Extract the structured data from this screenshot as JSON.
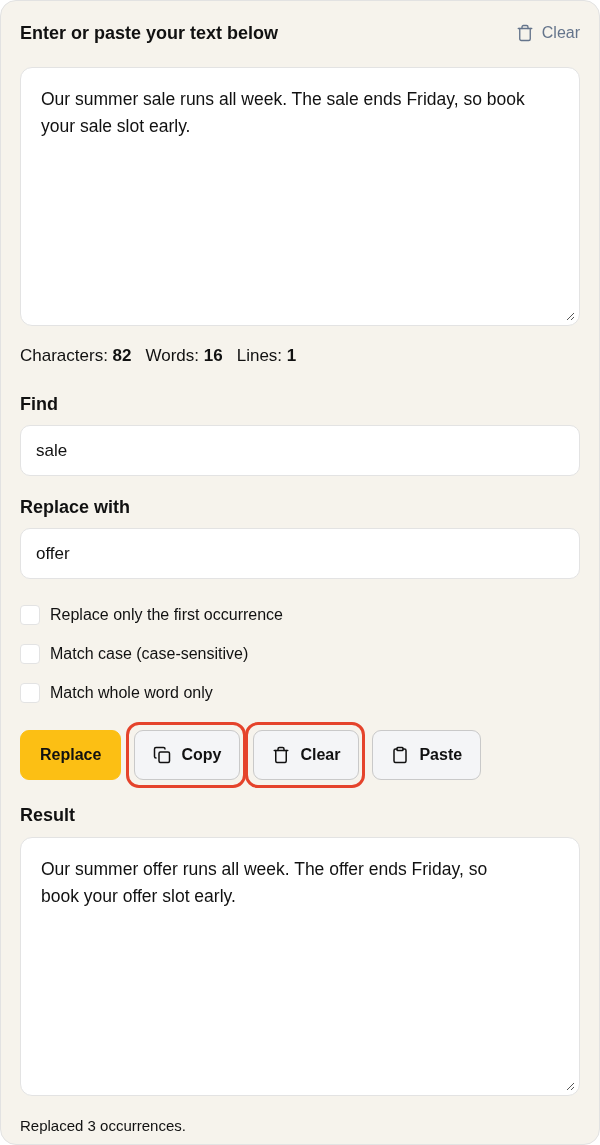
{
  "header": {
    "title": "Enter or paste your text below",
    "clear_label": "Clear"
  },
  "source": {
    "value": "Our summer sale runs all week. The sale ends Friday, so book your sale slot early."
  },
  "stats": [
    "Characters: **82**",
    "Words: **16**",
    "Lines: **1**"
  ],
  "find": {
    "label": "Find",
    "value": "sale"
  },
  "replace": {
    "label": "Replace with",
    "value": "offer"
  },
  "options": [
    {
      "label": "Replace only the first occurrence",
      "checked": false
    },
    {
      "label": "Match case (case-sensitive)",
      "checked": false
    },
    {
      "label": "Match whole word only",
      "checked": false
    }
  ],
  "buttons": [
    {
      "kind": "primary",
      "label": "Replace",
      "highlighted": false
    },
    {
      "kind": "copy",
      "label": "Copy",
      "highlighted": true
    },
    {
      "kind": "clear",
      "label": "Clear",
      "highlighted": true
    },
    {
      "kind": "paste",
      "label": "Paste",
      "highlighted": false
    }
  ],
  "result": {
    "label": "Result",
    "value": "Our summer offer runs all week. The offer ends Friday, so book your offer slot early."
  },
  "status": "Replaced 3 occurrences."
}
